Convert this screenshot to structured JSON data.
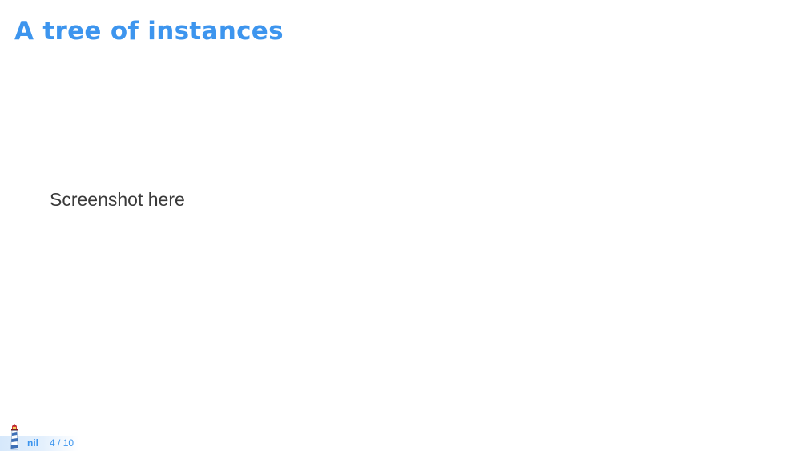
{
  "slide": {
    "title": "A tree of instances",
    "body_text": "Screenshot here"
  },
  "footer": {
    "logo_icon": "lighthouse-icon",
    "name": "nil",
    "current_page": "4",
    "separator": "/",
    "total_pages": "10"
  },
  "colors": {
    "accent": "#3d95ee",
    "body_text": "#3a3a3a",
    "background": "#ffffff"
  }
}
